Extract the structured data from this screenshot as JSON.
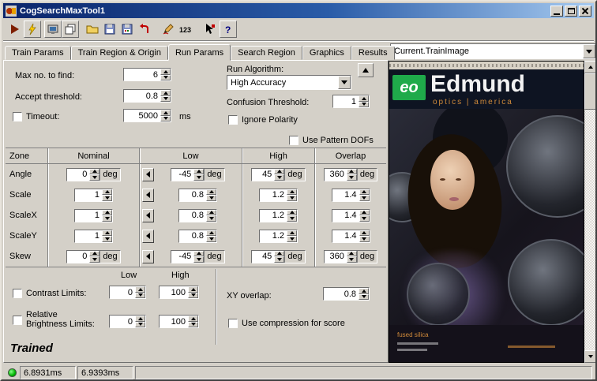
{
  "window": {
    "title": "CogSearchMaxTool1"
  },
  "toolbar": {
    "numbers_label": "123",
    "help_label": "?"
  },
  "tabs": {
    "items": [
      {
        "label": "Train Params"
      },
      {
        "label": "Train Region & Origin"
      },
      {
        "label": "Run Params"
      },
      {
        "label": "Search Region"
      },
      {
        "label": "Graphics"
      },
      {
        "label": "Results"
      }
    ],
    "active": "Run Params"
  },
  "run_params": {
    "max_find": {
      "label": "Max no. to find:",
      "value": "6"
    },
    "accept_threshold": {
      "label": "Accept threshold:",
      "value": "0.8"
    },
    "timeout": {
      "label": "Timeout:",
      "value": "5000",
      "unit": "ms"
    },
    "run_algorithm": {
      "label": "Run Algorithm:",
      "value": "High Accuracy"
    },
    "confusion_threshold": {
      "label": "Confusion Threshold:",
      "value": "1"
    },
    "ignore_polarity": {
      "label": "Ignore Polarity"
    },
    "use_pattern_dofs": {
      "label": "Use Pattern DOFs"
    }
  },
  "zone_table": {
    "headers": {
      "zone": "Zone",
      "nominal": "Nominal",
      "low": "Low",
      "high": "High",
      "overlap": "Overlap"
    },
    "unit_deg": "deg",
    "rows": [
      {
        "zone": "Angle",
        "nominal": "0",
        "low": "-45",
        "high": "45",
        "overlap": "360",
        "unit": "deg"
      },
      {
        "zone": "Scale",
        "nominal": "1",
        "low": "0.8",
        "high": "1.2",
        "overlap": "1.4"
      },
      {
        "zone": "ScaleX",
        "nominal": "1",
        "low": "0.8",
        "high": "1.2",
        "overlap": "1.4"
      },
      {
        "zone": "ScaleY",
        "nominal": "1",
        "low": "0.8",
        "high": "1.2",
        "overlap": "1.4"
      },
      {
        "zone": "Skew",
        "nominal": "0",
        "low": "-45",
        "high": "45",
        "overlap": "360",
        "unit": "deg"
      }
    ]
  },
  "limits": {
    "low_header": "Low",
    "high_header": "High",
    "contrast": {
      "label": "Contrast Limits:",
      "low": "0",
      "high": "100"
    },
    "brightness": {
      "label": "Relative Brightness Limits:",
      "low": "0",
      "high": "100"
    },
    "xy_overlap": {
      "label": "XY overlap:",
      "value": "0.8"
    },
    "compression": {
      "label": "Use compression for score"
    }
  },
  "status": {
    "trained": "Trained",
    "time1": "6.8931ms",
    "time2": "6.9393ms"
  },
  "image_panel": {
    "selector_value": "Current.TrainImage",
    "image": {
      "logo": "eo",
      "brand": "Edmund",
      "tagline": "optics | america",
      "caption": "fused silica"
    }
  }
}
